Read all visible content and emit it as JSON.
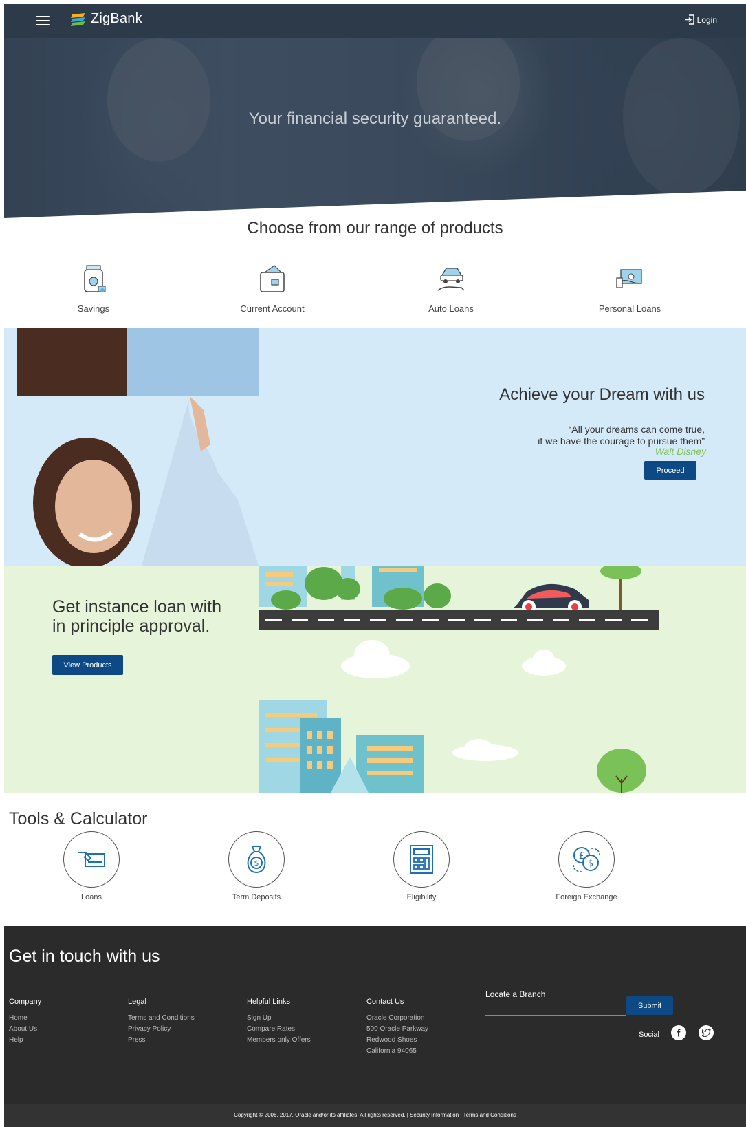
{
  "header": {
    "brand": "ZigBank",
    "login_label": "Login"
  },
  "hero": {
    "tagline": "Your financial security guaranteed."
  },
  "products": {
    "title": "Choose from our range of products",
    "items": [
      {
        "label": "Savings",
        "icon": "savings-jar-icon"
      },
      {
        "label": "Current Account",
        "icon": "wallet-icon"
      },
      {
        "label": "Auto Loans",
        "icon": "car-hand-icon"
      },
      {
        "label": "Personal Loans",
        "icon": "cash-hand-icon"
      }
    ]
  },
  "dream": {
    "title": "Achieve your Dream with us",
    "quote_line1": "“All your dreams can come true,",
    "quote_line2": "if we have the courage to pursue them”",
    "author": "Walt Disney",
    "button": "Proceed"
  },
  "loan": {
    "title_line1": "Get instance loan with",
    "title_line2": "in principle approval.",
    "button": "View Products"
  },
  "tools": {
    "title": "Tools & Calculator",
    "items": [
      {
        "label": "Loans",
        "icon": "loan-card-icon"
      },
      {
        "label": "Term Deposits",
        "icon": "money-bag-icon"
      },
      {
        "label": "Eligibility",
        "icon": "calculator-icon"
      },
      {
        "label": "Foreign Exchange",
        "icon": "currency-exchange-icon"
      }
    ]
  },
  "footer": {
    "title": "Get in touch with us",
    "company": {
      "heading": "Company",
      "links": [
        "Home",
        "About Us",
        "Help"
      ]
    },
    "legal": {
      "heading": "Legal",
      "links": [
        "Terms and Conditions",
        "Privacy Policy",
        "Press"
      ]
    },
    "helpful": {
      "heading": "Helpful Links",
      "links": [
        "Sign Up",
        "Compare Rates",
        "Members only Offers"
      ]
    },
    "contact": {
      "heading": "Contact Us",
      "lines": [
        "Oracle Corporation",
        "500 Oracle Parkway",
        "Redwood Shoes",
        "California 94065"
      ]
    },
    "locate_label": "Locate a Branch",
    "submit": "Submit",
    "social_label": "Social",
    "copyright_text": "Copyright © 2006, 2017, Oracle and/or its affiliates. All rights reserved. |",
    "security_link": "Security Information",
    "separator": "|",
    "terms_link": "Terms and Conditions"
  },
  "colors": {
    "header_bg": "#2c3a4a",
    "primary_button": "#0d4a85",
    "dream_bg": "#d5eaf9",
    "loan_bg": "#e6f4d9",
    "footer_bg": "#2b2b2b",
    "author_green": "#7ec15a"
  }
}
